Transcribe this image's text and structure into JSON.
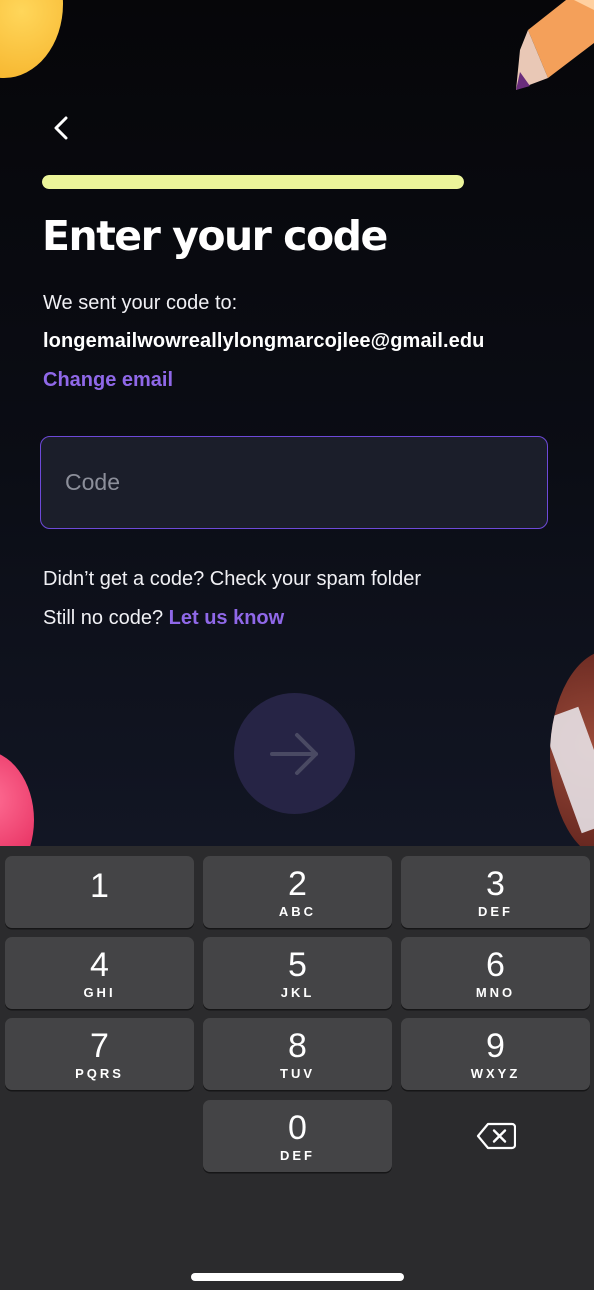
{
  "header": {
    "back_icon": "chevron-left-icon"
  },
  "progress": {
    "fraction": 1.0,
    "color": "#ecf59a"
  },
  "main": {
    "title": "Enter your code",
    "sent_label": "We sent your code to:",
    "email": "longemailwowreallylongmarcojlee@gmail.edu",
    "change_email_label": "Change email",
    "code_placeholder": "Code",
    "code_value": "",
    "help_line_1": "Didn’t get a code? Check your spam folder",
    "help_line_2_prefix": "Still no code?",
    "let_us_know_label": "Let us know",
    "next_icon": "arrow-right-icon"
  },
  "keyboard": {
    "keys": [
      {
        "digit": "1",
        "letters": ""
      },
      {
        "digit": "2",
        "letters": "ABC"
      },
      {
        "digit": "3",
        "letters": "DEF"
      },
      {
        "digit": "4",
        "letters": "GHI"
      },
      {
        "digit": "5",
        "letters": "JKL"
      },
      {
        "digit": "6",
        "letters": "MNO"
      },
      {
        "digit": "7",
        "letters": "PQRS"
      },
      {
        "digit": "8",
        "letters": "TUV"
      },
      {
        "digit": "9",
        "letters": "WXYZ"
      },
      {
        "digit": "0",
        "letters": "DEF"
      }
    ],
    "delete_icon": "backspace-icon"
  },
  "colors": {
    "accent": "#8f68e8",
    "field_border": "#6d49d8",
    "progress": "#ecf59a",
    "background": "#07080c"
  }
}
